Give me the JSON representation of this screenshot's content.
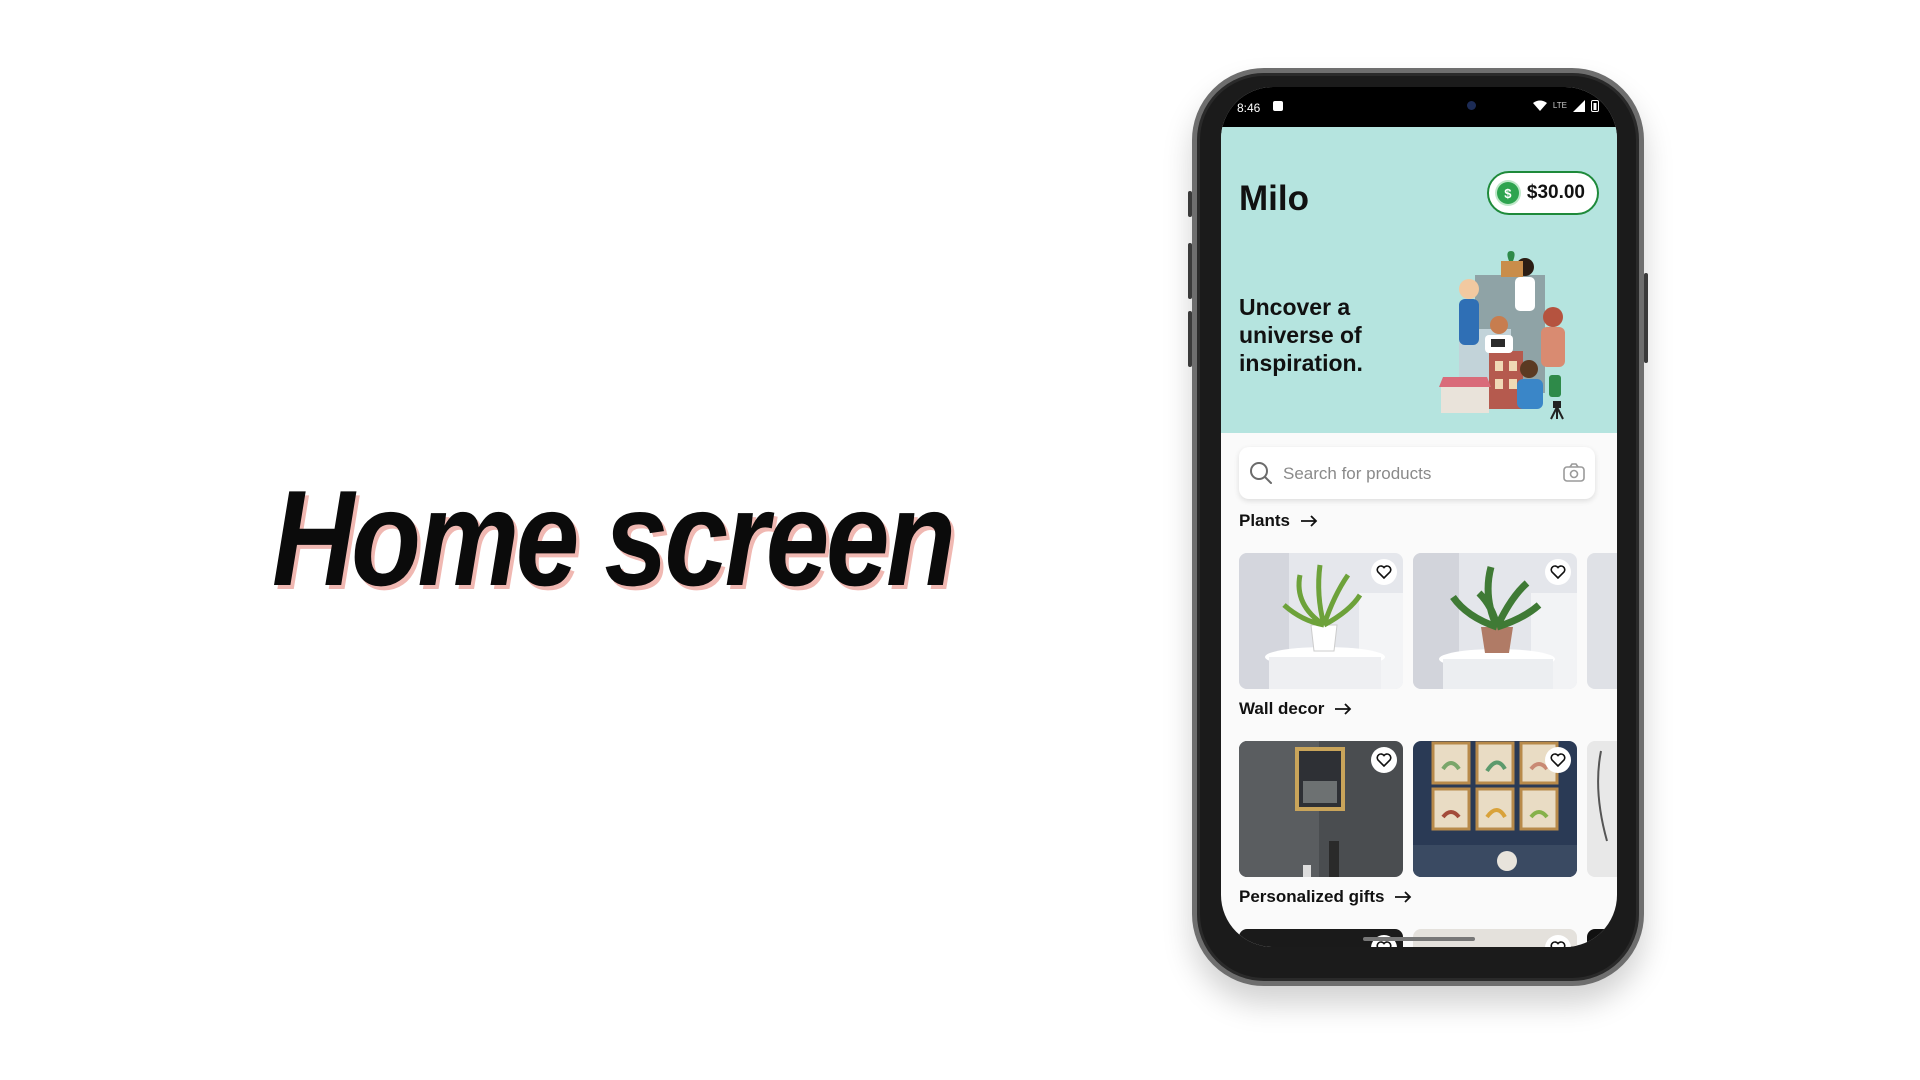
{
  "slide": {
    "headline": "Home screen"
  },
  "status_bar": {
    "time": "8:46",
    "network": "LTE"
  },
  "app": {
    "brand": "Milo",
    "balance": "$30.00",
    "balance_currency_symbol": "$",
    "tagline": "Uncover a universe of inspiration.",
    "search": {
      "placeholder": "Search for products"
    },
    "sections": [
      {
        "title": "Plants"
      },
      {
        "title": "Wall decor"
      },
      {
        "title": "Personalized gifts"
      }
    ]
  },
  "icons": [
    "search-icon",
    "camera-icon",
    "arrow-right-icon",
    "heart-icon",
    "dollar-coin-icon",
    "wifi-icon",
    "signal-icon",
    "battery-icon"
  ],
  "colors": {
    "hero_background": "#b5e4df",
    "balance_border": "#1e8a3a",
    "coin": "#2ea44f",
    "headline_shadow": "#f0b8b2"
  }
}
